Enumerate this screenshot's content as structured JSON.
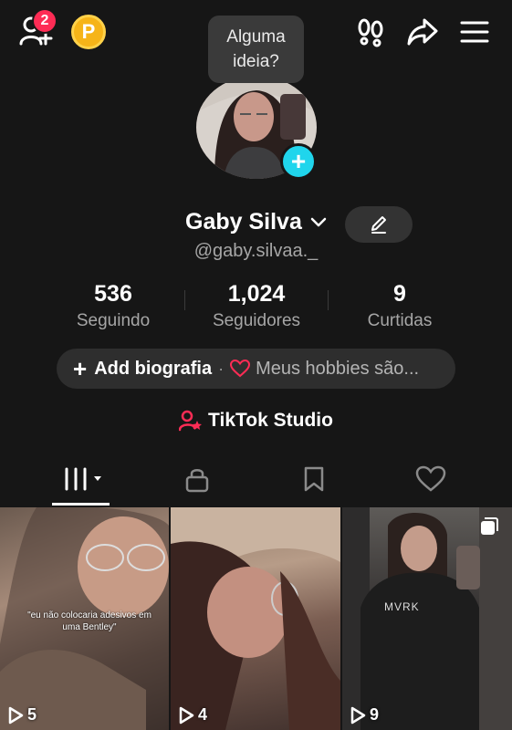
{
  "topbar": {
    "notification_count": "2",
    "coin_label": "P"
  },
  "tooltip": {
    "line1": "Alguma",
    "line2": "ideia?"
  },
  "profile": {
    "name": "Gaby Silva",
    "handle": "@gaby.silvaa._"
  },
  "stats": [
    {
      "value": "536",
      "label": "Seguindo"
    },
    {
      "value": "1,024",
      "label": "Seguidores"
    },
    {
      "value": "9",
      "label": "Curtidas"
    }
  ],
  "bio": {
    "plus": "+",
    "add_label": "Add biografia",
    "separator": "·",
    "hobbies_text": "Meus hobbies são..."
  },
  "studio": {
    "label": "TikTok Studio"
  },
  "tabs": [
    {
      "icon": "grid-icon",
      "active": true
    },
    {
      "icon": "lock-icon",
      "active": false
    },
    {
      "icon": "bookmark-icon",
      "active": false
    },
    {
      "icon": "heart-icon",
      "active": false
    }
  ],
  "videos": [
    {
      "views": "5",
      "caption": "\"eu não colocaria adesivos em uma Bentley\""
    },
    {
      "views": "4"
    },
    {
      "views": "9",
      "shirt_text": "MVRK"
    }
  ],
  "colors": {
    "background": "#161616",
    "accent_red": "#fe2c55",
    "accent_cyan": "#20d5ec",
    "coin": "#f6b418"
  }
}
